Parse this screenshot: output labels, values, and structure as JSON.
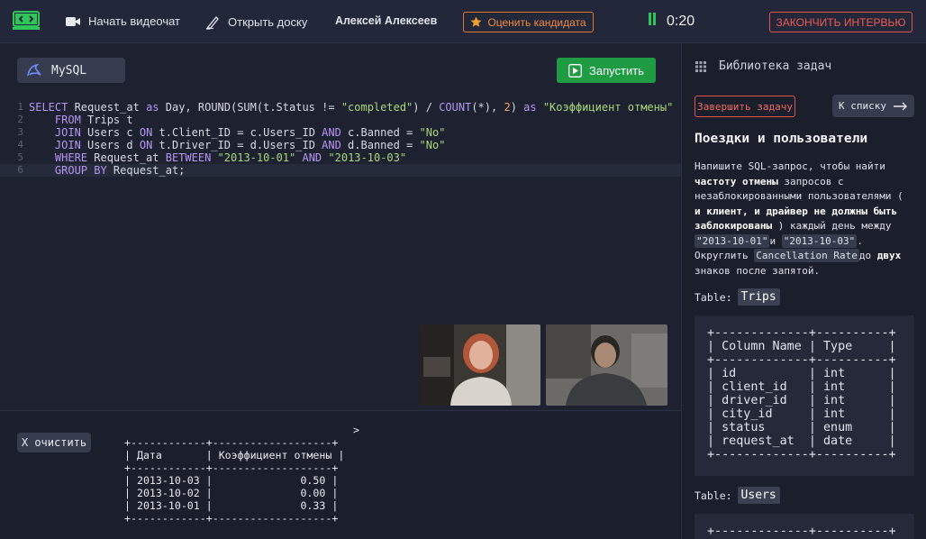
{
  "header": {
    "start_video": "Начать видеочат",
    "open_board": "Открыть доску",
    "candidate_name": "Алексей Алексеев",
    "rate_candidate": "Оценить кандидата",
    "timer": "0:20",
    "end_interview": "ЗАКОНЧИТЬ ИНТЕРВЬЮ"
  },
  "editor": {
    "language": "MySQL",
    "run_label": "Запустить",
    "line_numbers": [
      "1",
      "2",
      "3",
      "4",
      "5",
      "6"
    ]
  },
  "output": {
    "clear_label": "X очистить",
    "prompt_char": ">",
    "table": [
      "+------------+-------------------+",
      "| Дата       | Коэффициент отмены |",
      "+------------+-------------------+",
      "| 2013-10-03 |              0.50 |",
      "| 2013-10-02 |              0.00 |",
      "| 2013-10-01 |              0.33 |",
      "+------------+-------------------+"
    ]
  },
  "library": {
    "title": "Библиотека задач",
    "finish_task": "Завершить задачу",
    "to_list": "К списку",
    "task_title": "Поездки и пользователи",
    "desc": {
      "p1": "Напишите SQL-запрос, чтобы найти ",
      "b1": "частоту отмены",
      "p2": " запросов с незаблокированными пользователями ( ",
      "b2": "и клиент, и драйвер не должны быть заблокированы",
      "p3": " ) каждый день между ",
      "c1": "\"2013-10-01\"",
      "p4": "и ",
      "c2": "\"2013-10-03\"",
      "p5": ". Округлить ",
      "c3": "Cancellation Rate",
      "p6": "до ",
      "b3": "двух",
      "p7": " знаков после запятой."
    },
    "table_prefix": "Table:",
    "trips_name": "Trips",
    "users_name": "Users",
    "trips_schema": [
      "+-------------+----------+",
      "| Column Name | Type     |",
      "+-------------+----------+",
      "| id          | int      |",
      "| client_id   | int      |",
      "| driver_id   | int      |",
      "| city_id     | int      |",
      "| status      | enum     |",
      "| request_at  | date     |",
      "+-------------+----------+"
    ],
    "users_schema_first": "+-------------+----------+"
  },
  "icons": {
    "logo": "logo-icon",
    "video": "video-camera-icon",
    "board": "pen-icon",
    "star": "star-icon",
    "pause": "pause-icon",
    "mysql": "dolphin-icon",
    "play": "play-icon",
    "grid": "grid-icon",
    "arrow": "arrow-right-icon"
  },
  "colors": {
    "accent_green": "#1f9b43",
    "accent_orange": "#e07a2e",
    "accent_red": "#e0534a"
  }
}
